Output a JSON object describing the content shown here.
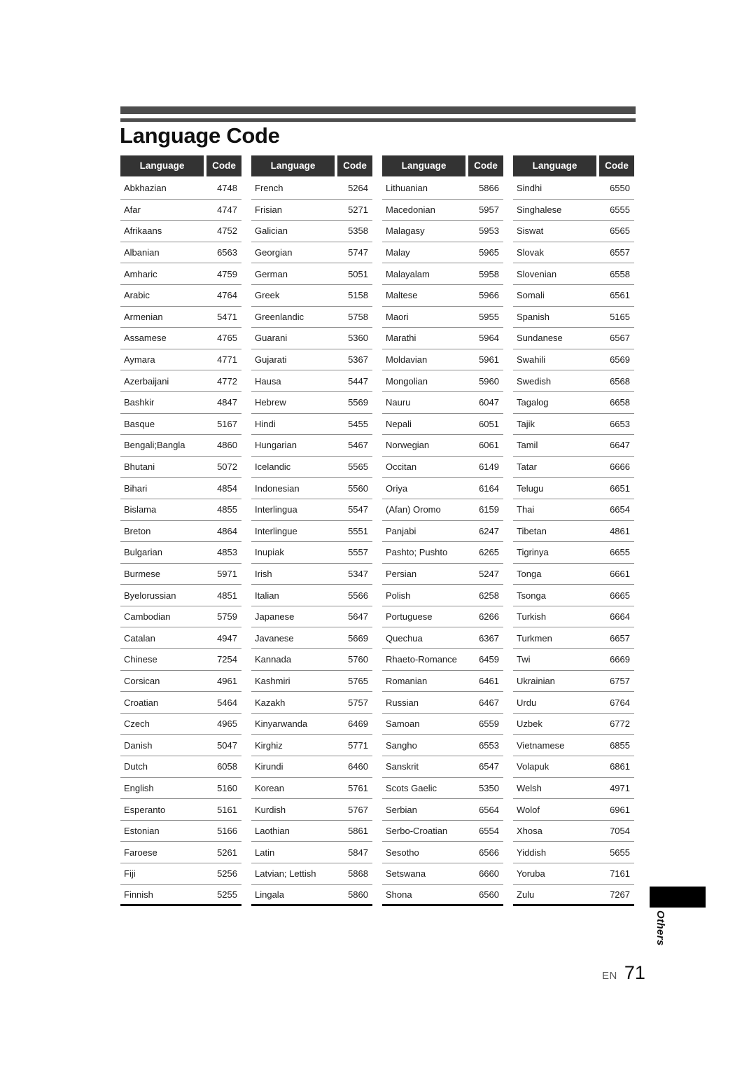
{
  "document": {
    "title": "Language Code",
    "side_tab_label": "Others",
    "footer": {
      "locale": "EN",
      "page_number": "71"
    },
    "colors": {
      "rule": "#4d4d4d",
      "header_bg": "#333333",
      "header_text": "#ffffff",
      "row_separator": "#8c8c8c",
      "table_bottom_border": "#111111",
      "side_tab": "#000000"
    }
  },
  "table": {
    "headers": {
      "language": "Language",
      "code": "Code"
    },
    "columns": [
      {
        "rows": [
          {
            "language": "Abkhazian",
            "code": "4748"
          },
          {
            "language": "Afar",
            "code": "4747"
          },
          {
            "language": "Afrikaans",
            "code": "4752"
          },
          {
            "language": "Albanian",
            "code": "6563"
          },
          {
            "language": "Amharic",
            "code": "4759"
          },
          {
            "language": "Arabic",
            "code": "4764"
          },
          {
            "language": "Armenian",
            "code": "5471"
          },
          {
            "language": "Assamese",
            "code": "4765"
          },
          {
            "language": "Aymara",
            "code": "4771"
          },
          {
            "language": "Azerbaijani",
            "code": "4772"
          },
          {
            "language": "Bashkir",
            "code": "4847"
          },
          {
            "language": "Basque",
            "code": "5167"
          },
          {
            "language": "Bengali;Bangla",
            "code": "4860"
          },
          {
            "language": "Bhutani",
            "code": "5072"
          },
          {
            "language": "Bihari",
            "code": "4854"
          },
          {
            "language": "Bislama",
            "code": "4855"
          },
          {
            "language": "Breton",
            "code": "4864"
          },
          {
            "language": "Bulgarian",
            "code": "4853"
          },
          {
            "language": "Burmese",
            "code": "5971"
          },
          {
            "language": "Byelorussian",
            "code": "4851"
          },
          {
            "language": "Cambodian",
            "code": "5759"
          },
          {
            "language": "Catalan",
            "code": "4947"
          },
          {
            "language": "Chinese",
            "code": "7254"
          },
          {
            "language": "Corsican",
            "code": "4961"
          },
          {
            "language": "Croatian",
            "code": "5464"
          },
          {
            "language": "Czech",
            "code": "4965"
          },
          {
            "language": "Danish",
            "code": "5047"
          },
          {
            "language": "Dutch",
            "code": "6058"
          },
          {
            "language": "English",
            "code": "5160"
          },
          {
            "language": "Esperanto",
            "code": "5161"
          },
          {
            "language": "Estonian",
            "code": "5166"
          },
          {
            "language": "Faroese",
            "code": "5261"
          },
          {
            "language": "Fiji",
            "code": "5256"
          },
          {
            "language": "Finnish",
            "code": "5255"
          }
        ]
      },
      {
        "rows": [
          {
            "language": "French",
            "code": "5264"
          },
          {
            "language": "Frisian",
            "code": "5271"
          },
          {
            "language": "Galician",
            "code": "5358"
          },
          {
            "language": "Georgian",
            "code": "5747"
          },
          {
            "language": "German",
            "code": "5051"
          },
          {
            "language": "Greek",
            "code": "5158"
          },
          {
            "language": "Greenlandic",
            "code": "5758"
          },
          {
            "language": "Guarani",
            "code": "5360"
          },
          {
            "language": "Gujarati",
            "code": "5367"
          },
          {
            "language": "Hausa",
            "code": "5447"
          },
          {
            "language": "Hebrew",
            "code": "5569"
          },
          {
            "language": "Hindi",
            "code": "5455"
          },
          {
            "language": "Hungarian",
            "code": "5467"
          },
          {
            "language": "Icelandic",
            "code": "5565"
          },
          {
            "language": "Indonesian",
            "code": "5560"
          },
          {
            "language": "Interlingua",
            "code": "5547"
          },
          {
            "language": "Interlingue",
            "code": "5551"
          },
          {
            "language": "Inupiak",
            "code": "5557"
          },
          {
            "language": "Irish",
            "code": "5347"
          },
          {
            "language": "Italian",
            "code": "5566"
          },
          {
            "language": "Japanese",
            "code": "5647"
          },
          {
            "language": "Javanese",
            "code": "5669"
          },
          {
            "language": "Kannada",
            "code": "5760"
          },
          {
            "language": "Kashmiri",
            "code": "5765"
          },
          {
            "language": "Kazakh",
            "code": "5757"
          },
          {
            "language": "Kinyarwanda",
            "code": "6469"
          },
          {
            "language": "Kirghiz",
            "code": "5771"
          },
          {
            "language": "Kirundi",
            "code": "6460"
          },
          {
            "language": "Korean",
            "code": "5761"
          },
          {
            "language": "Kurdish",
            "code": "5767"
          },
          {
            "language": "Laothian",
            "code": "5861"
          },
          {
            "language": "Latin",
            "code": "5847"
          },
          {
            "language": "Latvian; Lettish",
            "code": "5868"
          },
          {
            "language": "Lingala",
            "code": "5860"
          }
        ]
      },
      {
        "rows": [
          {
            "language": "Lithuanian",
            "code": "5866"
          },
          {
            "language": "Macedonian",
            "code": "5957"
          },
          {
            "language": "Malagasy",
            "code": "5953"
          },
          {
            "language": "Malay",
            "code": "5965"
          },
          {
            "language": "Malayalam",
            "code": "5958"
          },
          {
            "language": "Maltese",
            "code": "5966"
          },
          {
            "language": "Maori",
            "code": "5955"
          },
          {
            "language": "Marathi",
            "code": "5964"
          },
          {
            "language": "Moldavian",
            "code": "5961"
          },
          {
            "language": "Mongolian",
            "code": "5960"
          },
          {
            "language": "Nauru",
            "code": "6047"
          },
          {
            "language": "Nepali",
            "code": "6051"
          },
          {
            "language": "Norwegian",
            "code": "6061"
          },
          {
            "language": "Occitan",
            "code": "6149"
          },
          {
            "language": "Oriya",
            "code": "6164"
          },
          {
            "language": "(Afan) Oromo",
            "code": "6159"
          },
          {
            "language": "Panjabi",
            "code": "6247"
          },
          {
            "language": "Pashto; Pushto",
            "code": "6265"
          },
          {
            "language": "Persian",
            "code": "5247"
          },
          {
            "language": "Polish",
            "code": "6258"
          },
          {
            "language": "Portuguese",
            "code": "6266"
          },
          {
            "language": "Quechua",
            "code": "6367"
          },
          {
            "language": "Rhaeto-Romance",
            "code": "6459"
          },
          {
            "language": "Romanian",
            "code": "6461"
          },
          {
            "language": "Russian",
            "code": "6467"
          },
          {
            "language": "Samoan",
            "code": "6559"
          },
          {
            "language": "Sangho",
            "code": "6553"
          },
          {
            "language": "Sanskrit",
            "code": "6547"
          },
          {
            "language": "Scots Gaelic",
            "code": "5350"
          },
          {
            "language": "Serbian",
            "code": "6564"
          },
          {
            "language": "Serbo-Croatian",
            "code": "6554"
          },
          {
            "language": "Sesotho",
            "code": "6566"
          },
          {
            "language": "Setswana",
            "code": "6660"
          },
          {
            "language": "Shona",
            "code": "6560"
          }
        ]
      },
      {
        "rows": [
          {
            "language": "Sindhi",
            "code": "6550"
          },
          {
            "language": "Singhalese",
            "code": "6555"
          },
          {
            "language": "Siswat",
            "code": "6565"
          },
          {
            "language": "Slovak",
            "code": "6557"
          },
          {
            "language": "Slovenian",
            "code": "6558"
          },
          {
            "language": "Somali",
            "code": "6561"
          },
          {
            "language": "Spanish",
            "code": "5165"
          },
          {
            "language": "Sundanese",
            "code": "6567"
          },
          {
            "language": "Swahili",
            "code": "6569"
          },
          {
            "language": "Swedish",
            "code": "6568"
          },
          {
            "language": "Tagalog",
            "code": "6658"
          },
          {
            "language": "Tajik",
            "code": "6653"
          },
          {
            "language": "Tamil",
            "code": "6647"
          },
          {
            "language": "Tatar",
            "code": "6666"
          },
          {
            "language": "Telugu",
            "code": "6651"
          },
          {
            "language": "Thai",
            "code": "6654"
          },
          {
            "language": "Tibetan",
            "code": "4861"
          },
          {
            "language": "Tigrinya",
            "code": "6655"
          },
          {
            "language": "Tonga",
            "code": "6661"
          },
          {
            "language": "Tsonga",
            "code": "6665"
          },
          {
            "language": "Turkish",
            "code": "6664"
          },
          {
            "language": "Turkmen",
            "code": "6657"
          },
          {
            "language": "Twi",
            "code": "6669"
          },
          {
            "language": "Ukrainian",
            "code": "6757"
          },
          {
            "language": "Urdu",
            "code": "6764"
          },
          {
            "language": "Uzbek",
            "code": "6772"
          },
          {
            "language": "Vietnamese",
            "code": "6855"
          },
          {
            "language": "Volapuk",
            "code": "6861"
          },
          {
            "language": "Welsh",
            "code": "4971"
          },
          {
            "language": "Wolof",
            "code": "6961"
          },
          {
            "language": "Xhosa",
            "code": "7054"
          },
          {
            "language": "Yiddish",
            "code": "5655"
          },
          {
            "language": "Yoruba",
            "code": "7161"
          },
          {
            "language": "Zulu",
            "code": "7267"
          }
        ]
      }
    ]
  }
}
